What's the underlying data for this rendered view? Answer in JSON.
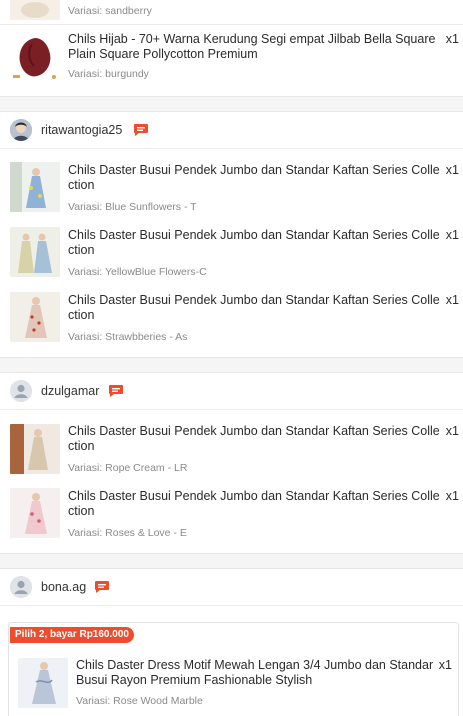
{
  "orders": {
    "top_partial": {
      "variant": "Variasi: sandberry"
    },
    "hijab": {
      "title": "Chils Hijab - 70+ Warna Kerudung Segi empat Jilbab Bella Square Plain Square Pollycotton Premium",
      "qty": "x1",
      "variant": "Variasi: burgundy"
    }
  },
  "shops": [
    {
      "name": "ritawantogia25",
      "items": [
        {
          "title": "Chils Daster Busui Pendek Jumbo dan Standar Kaftan Series Collection",
          "qty": "x1",
          "variant": "Variasi: Blue Sunflowers - T"
        },
        {
          "title": "Chils Daster Busui Pendek Jumbo dan Standar Kaftan Series Collection",
          "qty": "x1",
          "variant": "Variasi: YellowBlue Flowers-C"
        },
        {
          "title": "Chils Daster Busui Pendek Jumbo dan Standar Kaftan Series Collection",
          "qty": "x1",
          "variant": "Variasi: Strawbberies - As"
        }
      ]
    },
    {
      "name": "dzulgamar",
      "items": [
        {
          "title": "Chils Daster Busui Pendek Jumbo dan Standar Kaftan Series Collection",
          "qty": "x1",
          "variant": "Variasi: Rope Cream - LR"
        },
        {
          "title": "Chils Daster Busui Pendek Jumbo dan Standar Kaftan Series Collection",
          "qty": "x1",
          "variant": "Variasi: Roses & Love - E"
        }
      ]
    },
    {
      "name": "bona.ag",
      "promo_badge": "Pilih 2, bayar Rp160.000",
      "items": [
        {
          "title": "Chils Daster Dress Motif Mewah Lengan 3/4 Jumbo dan Standar Busui Rayon Premium Fashionable Stylish",
          "qty": "x1",
          "variant": "Variasi: Rose Wood Marble"
        }
      ]
    }
  ],
  "colors": {
    "accent": "#ee4d2d",
    "divider_band": "#f5f5f5",
    "variant_text": "#8a8a8a"
  },
  "icons": {
    "chat": "chat-bubble-icon",
    "avatar_default": "user-avatar-icon"
  }
}
